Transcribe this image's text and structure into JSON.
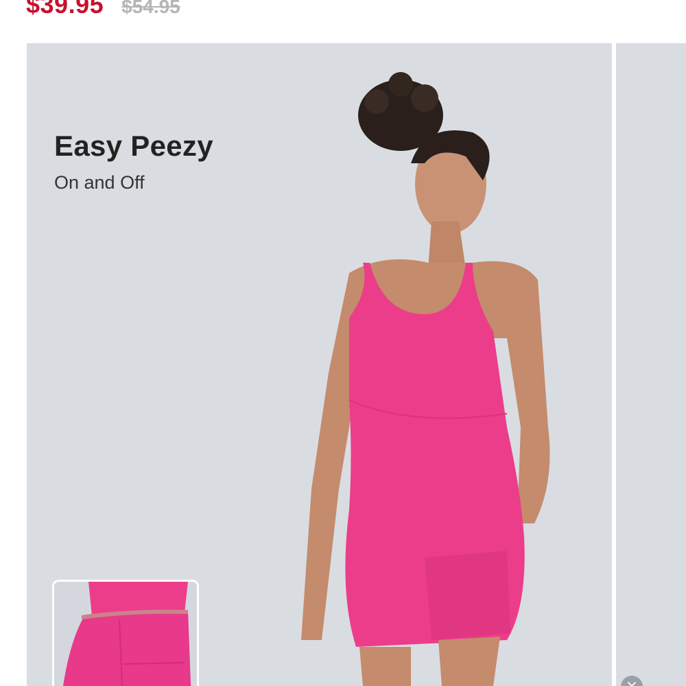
{
  "product": {
    "price_current": "$39.95",
    "price_original": "$54.95"
  },
  "banner": {
    "headline": "Easy Peezy",
    "subline": "On and Off"
  },
  "colors": {
    "price_accent": "#c8102e",
    "dress": "#ec3d8a",
    "card_background": "#d9dde2"
  },
  "icons": {
    "close": "close-icon"
  },
  "glyphs": {
    "close": "×"
  }
}
